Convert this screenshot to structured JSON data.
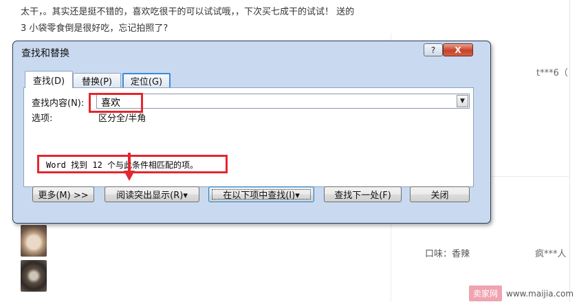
{
  "background": {
    "text_line_1": "太干，。其实还是挺不错的，喜欢吃很干的可以试试哦，，下次买七成干的试试！ 送的",
    "text_line_2": "3 小袋零食倒是很好吃，忘记拍照了?",
    "reviewer_1": "t***6（",
    "flavor_label": "口味：香辣",
    "reviewer_2": "疯***人"
  },
  "dialog": {
    "title": "查找和替换",
    "help_label": "?",
    "close_label": "X",
    "tabs": [
      {
        "label": "查找(D)",
        "active": true
      },
      {
        "label": "替换(P)",
        "active": false
      },
      {
        "label": "定位(G)",
        "active": false
      }
    ],
    "find_label": "查找内容(N):",
    "find_value": "喜欢",
    "options_label": "选项:",
    "options_value": "区分全/半角",
    "result_message": "Word 找到 12 个与此条件相匹配的项。",
    "buttons": {
      "more": "更多(M) >>",
      "reading_highlight": "阅读突出显示(R)▾",
      "find_in": "在以下项中查找(I)▾",
      "find_next": "查找下一处(F)",
      "close": "关闭"
    },
    "annotation_color": "#e4262d"
  },
  "watermark": {
    "logo": "卖家网",
    "url": "www.maijia.com"
  }
}
